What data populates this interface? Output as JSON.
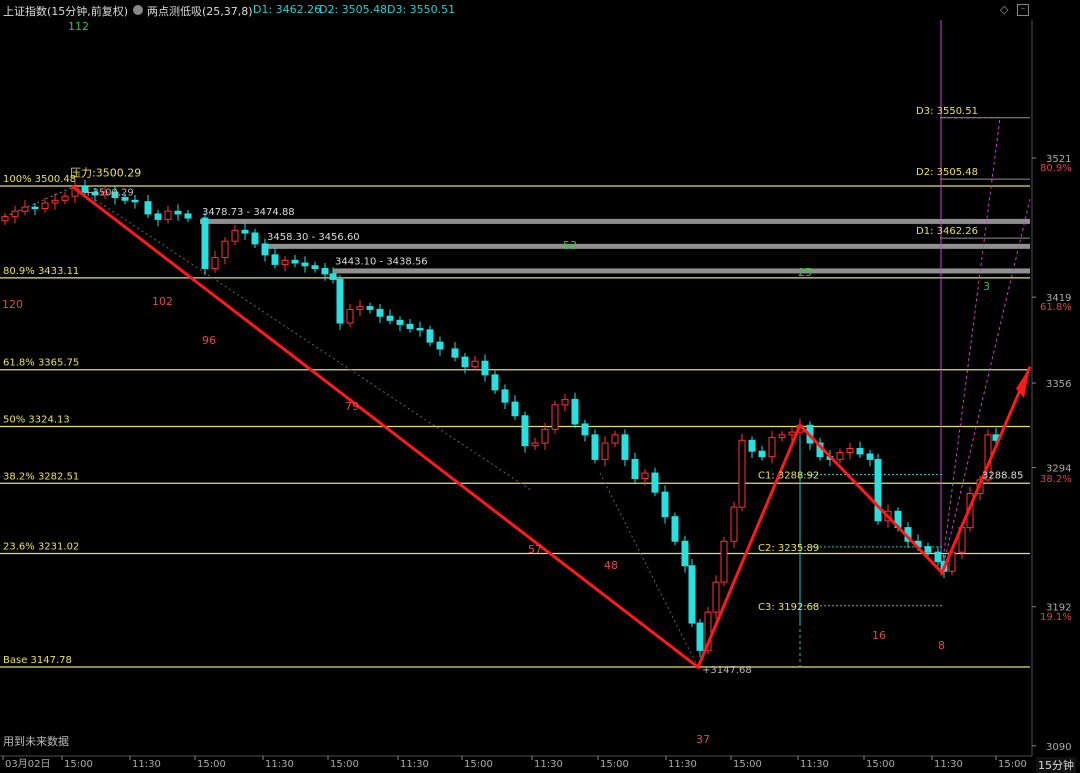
{
  "header": {
    "title": "上证指数(15分钟,前复权)",
    "indicator": "两点测低吸(25,37,8)",
    "d1": "D1: 3462.26",
    "d2": "D2: 3505.48",
    "d3": "D3: 3550.51",
    "icons": [
      "diamond-icon",
      "minimize-icon"
    ]
  },
  "colors": {
    "up": "#ff3232",
    "down": "#28e0e0",
    "level_line": "#e8e060",
    "wave": "#ff1a1a",
    "zone": "#909090"
  },
  "chart_data": {
    "type": "candlestick",
    "y_axis": {
      "ticks": [
        3090,
        3192,
        3294,
        3356,
        3419,
        3521
      ]
    },
    "y_axis_pct": [
      "80.9%",
      "61.8%",
      "38.2%",
      "19.1%"
    ],
    "x_axis": {
      "labels": [
        "03月02日",
        "15:00",
        "11:30",
        "15:00",
        "11:30",
        "15:00",
        "11:30",
        "15:00",
        "11:30",
        "15:00",
        "11:30",
        "15:00",
        "11:30",
        "15:00",
        "11:30",
        "15:00",
        "11:30",
        "15:00"
      ]
    },
    "fib_levels": [
      {
        "label": "100% 3500.48",
        "value": 3500.48
      },
      {
        "label": "80.9% 3433.11",
        "value": 3433.11
      },
      {
        "label": "61.8% 3365.75",
        "value": 3365.75
      },
      {
        "label": "50% 3324.13",
        "value": 3324.13
      },
      {
        "label": "38.2% 3282.51",
        "value": 3282.51
      },
      {
        "label": "23.6% 3231.02",
        "value": 3231.02
      },
      {
        "label": "Base 3147.78",
        "value": 3147.78
      }
    ],
    "pressure_label": "压力:3500.29",
    "high_label": "3500.29",
    "low_label": "3147.68",
    "zones": [
      "3478.73 - 3474.88",
      "3458.30 - 3456.60",
      "3443.10 - 3438.56"
    ],
    "targets": [
      {
        "label": "D3: 3550.51",
        "value": 3550.51
      },
      {
        "label": "D2: 3505.48",
        "value": 3505.48
      },
      {
        "label": "D1: 3462.26",
        "value": 3462.26
      }
    ],
    "c_levels": [
      {
        "label": "C1: 3288.92",
        "value": 3288.92
      },
      {
        "label": "C2: 3235.89",
        "value": 3235.89
      },
      {
        "label": "C3: 3192.68",
        "value": 3192.68
      }
    ],
    "last_label": "3288.85",
    "wave_counts": [
      {
        "text": "112",
        "color": "green"
      },
      {
        "text": "120",
        "color": "red"
      },
      {
        "text": "102",
        "color": "red"
      },
      {
        "text": "96",
        "color": "red"
      },
      {
        "text": "79",
        "color": "red"
      },
      {
        "text": "53",
        "color": "green"
      },
      {
        "text": "57",
        "color": "red"
      },
      {
        "text": "48",
        "color": "red"
      },
      {
        "text": "37",
        "color": "red"
      },
      {
        "text": "25",
        "color": "green"
      },
      {
        "text": "16",
        "color": "red"
      },
      {
        "text": "8",
        "color": "red"
      },
      {
        "text": "3",
        "color": "green"
      }
    ]
  },
  "footer_note": "用到未来数据",
  "period": "15分钟"
}
